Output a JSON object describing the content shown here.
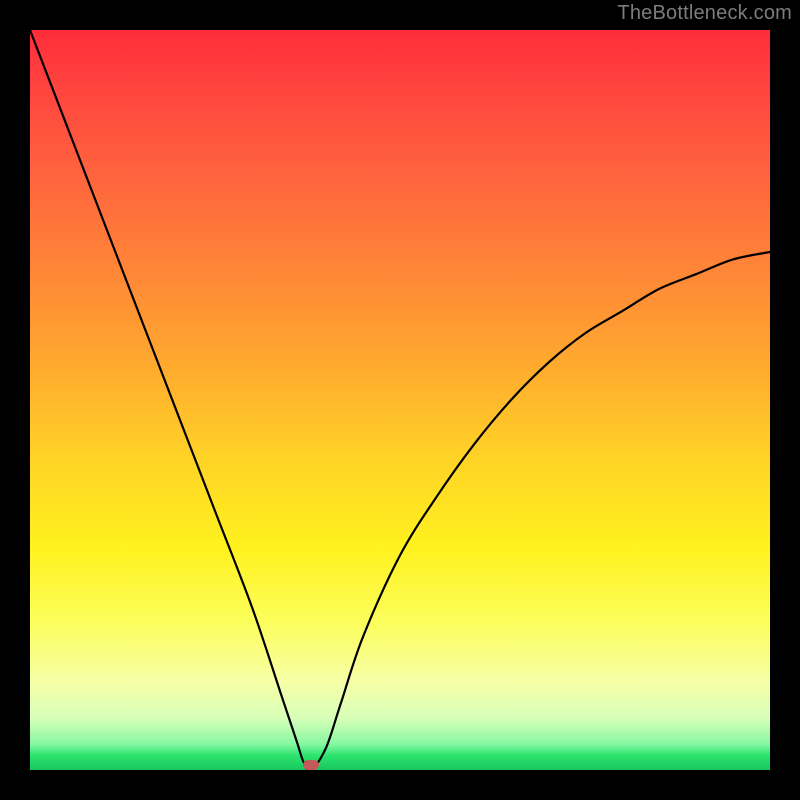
{
  "watermark": {
    "text": "TheBottleneck.com"
  },
  "colors": {
    "background": "#000000",
    "gradient_top": "#ff2d3a",
    "gradient_mid": "#ffd326",
    "gradient_bottom": "#18c75e",
    "curve": "#000000",
    "marker": "#c25a5a"
  },
  "chart_data": {
    "type": "line",
    "title": "",
    "xlabel": "",
    "ylabel": "",
    "xlim": [
      0,
      100
    ],
    "ylim": [
      0,
      100
    ],
    "grid": false,
    "legend": false,
    "description": "Bottleneck curve: steep V with minimum near x≈38, left arm reaching top-left corner, right arm rising toward ~70% height at right edge. Background vertical gradient from red (high bottleneck) to green (low bottleneck).",
    "series": [
      {
        "name": "bottleneck-curve",
        "x": [
          0,
          5,
          10,
          15,
          20,
          25,
          30,
          34,
          36,
          37,
          38,
          40,
          42,
          45,
          50,
          55,
          60,
          65,
          70,
          75,
          80,
          85,
          90,
          95,
          100
        ],
        "values": [
          100,
          87,
          74,
          61,
          48,
          35,
          22,
          10,
          4,
          1,
          0,
          3,
          9,
          18,
          29,
          37,
          44,
          50,
          55,
          59,
          62,
          65,
          67,
          69,
          70
        ]
      }
    ],
    "annotations": [
      {
        "name": "optimal-marker",
        "x": 38,
        "y": 0.7
      }
    ]
  }
}
